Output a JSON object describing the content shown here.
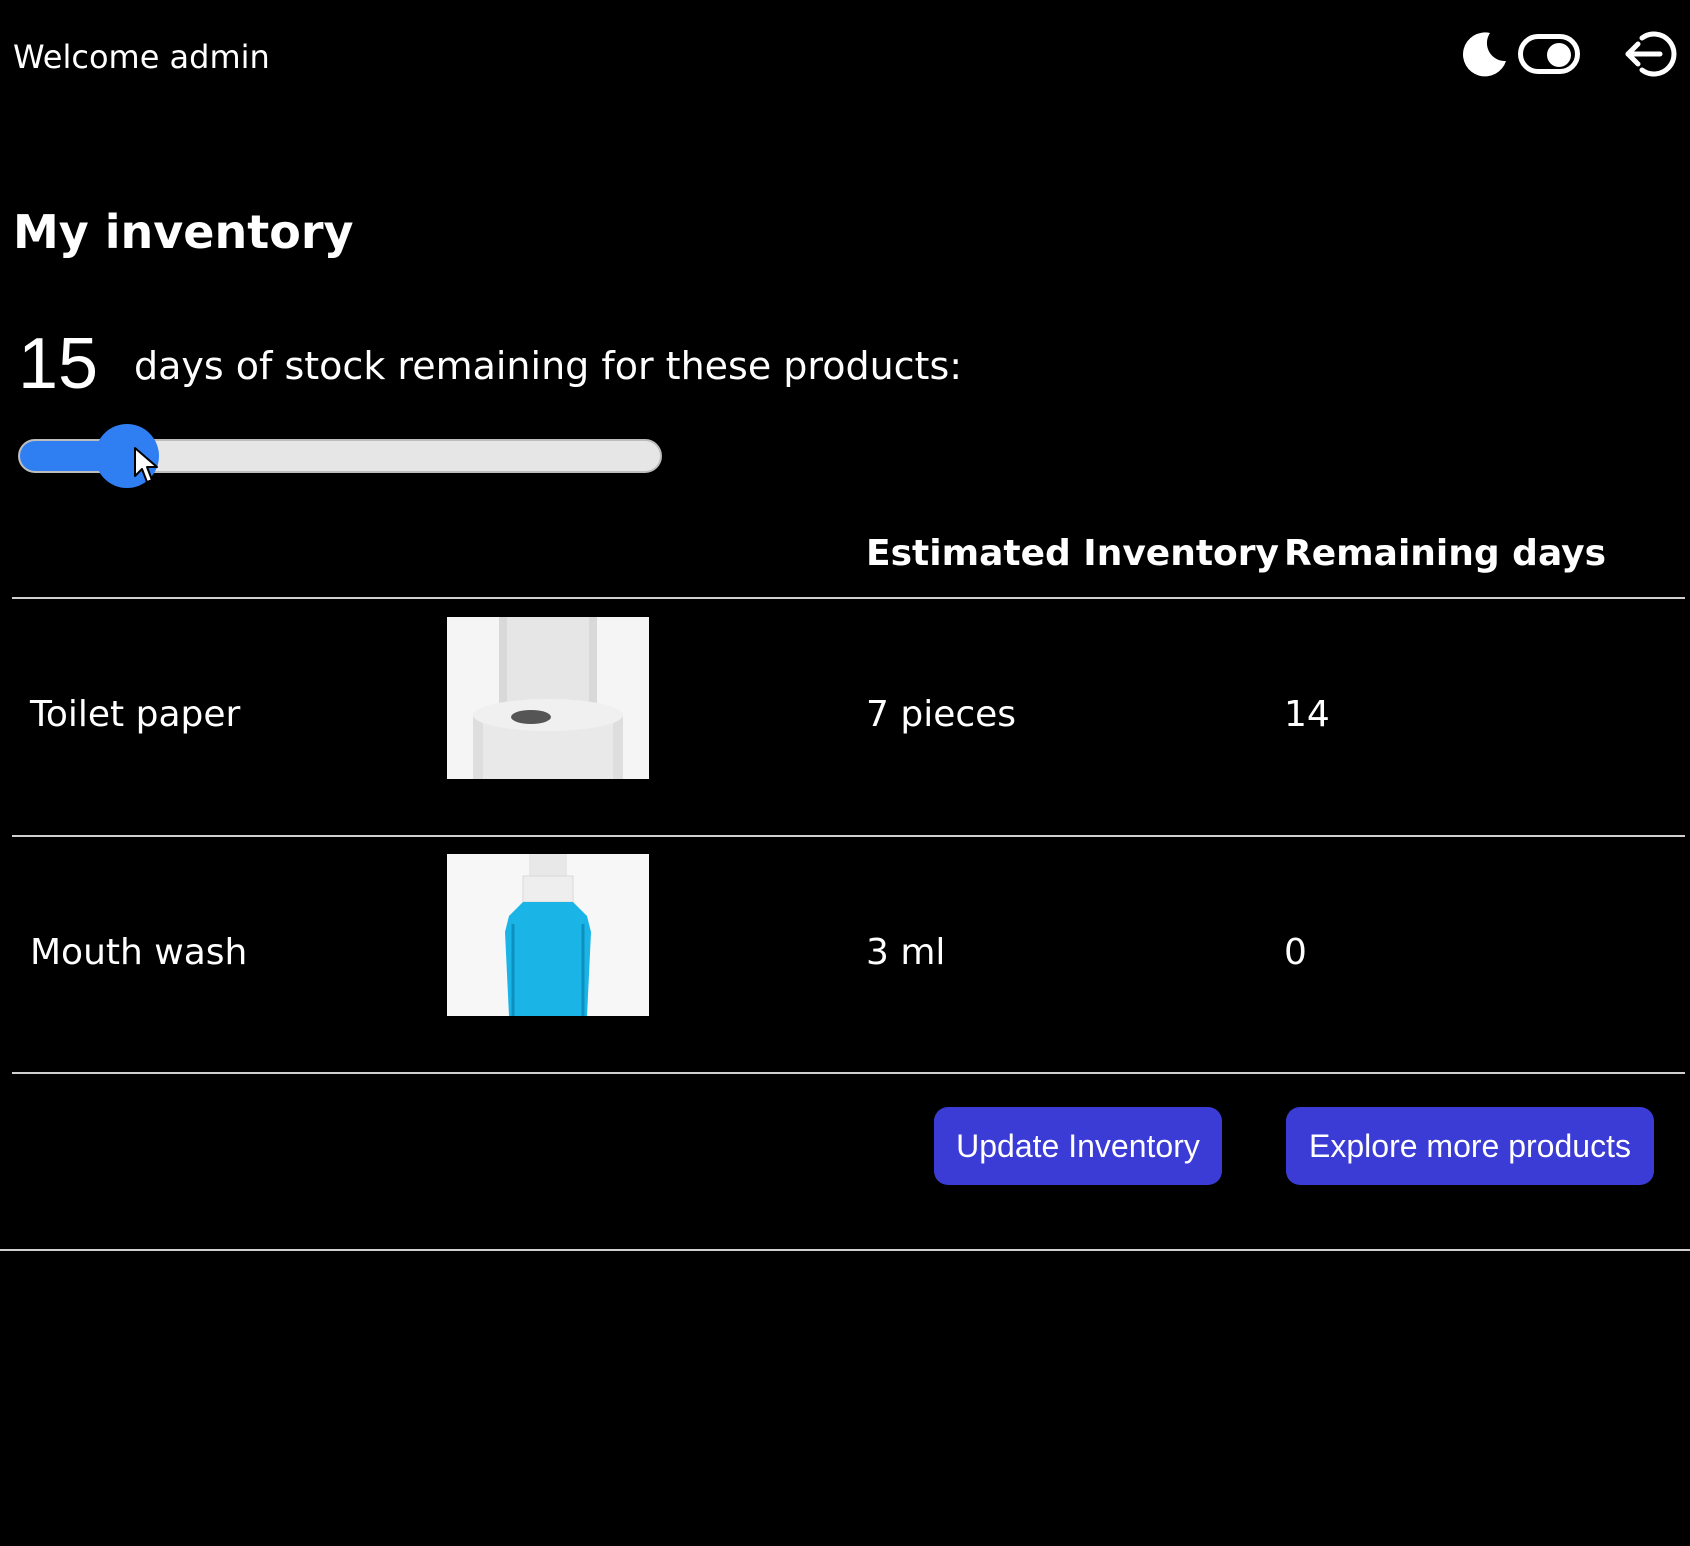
{
  "header": {
    "welcome": "Welcome admin",
    "icons": [
      "moon-icon",
      "theme-toggle",
      "logout-icon"
    ]
  },
  "main": {
    "title": "My inventory",
    "days_value": "15",
    "days_text": "days of stock remaining for these products:",
    "slider": {
      "value": 15,
      "min": 0,
      "max": 90,
      "fraction": 0.17
    }
  },
  "table": {
    "headers": [
      "Estimated Inventory",
      "Remaining days"
    ],
    "rows": [
      {
        "name": "Toilet paper",
        "image": "toilet-paper-image",
        "inventory": "7 pieces",
        "remaining": "14"
      },
      {
        "name": "Mouth wash",
        "image": "mouth-wash-image",
        "inventory": "3 ml",
        "remaining": "0"
      }
    ]
  },
  "actions": {
    "update": "Update Inventory",
    "explore": "Explore more products"
  },
  "colors": {
    "background": "#000000",
    "accent": "#2f7ef2",
    "button": "#3b3bd6"
  }
}
